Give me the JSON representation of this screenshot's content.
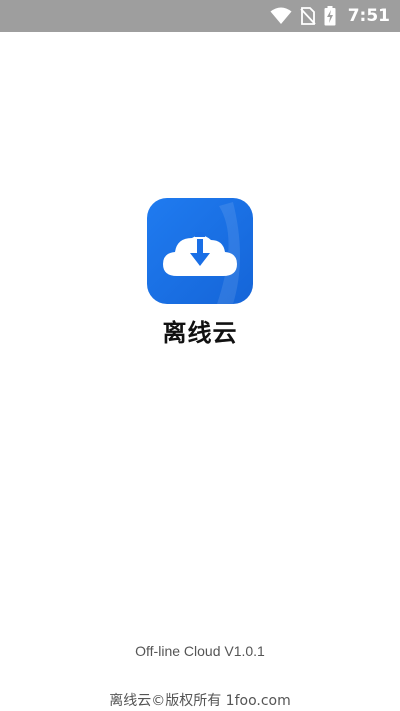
{
  "status_bar": {
    "time": "7:51",
    "icons": [
      "wifi-icon",
      "no-sim-icon",
      "battery-charging-icon"
    ],
    "background": "#9e9e9e"
  },
  "splash": {
    "app_name": "离线云",
    "version": "Off-line Cloud V1.0.1",
    "copyright": "离线云©版权所有 1foo.com",
    "icon": "cloud-download-icon",
    "brand_color": "#1a73e8"
  }
}
